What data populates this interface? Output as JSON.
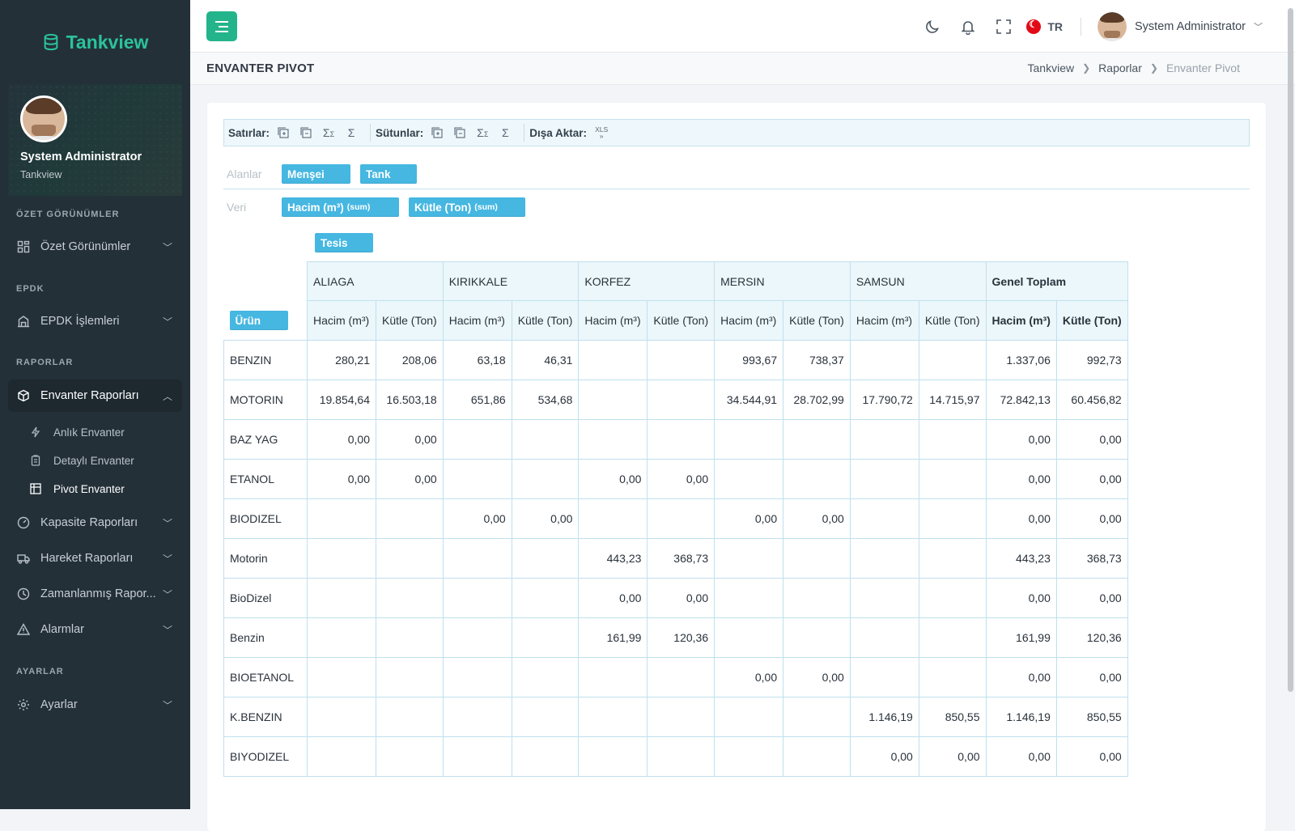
{
  "brand": {
    "name": "Tankview"
  },
  "profile": {
    "name": "System Administrator",
    "org": "Tankview"
  },
  "nav": {
    "sections": {
      "ozet": "ÖZET GÖRÜNÜMLER",
      "epdk": "EPDK",
      "raporlar": "RAPORLAR",
      "ayarlar": "AYARLAR"
    },
    "items": {
      "ozet": "Özet Görünümler",
      "epdk": "EPDK İşlemleri",
      "envanter": "Envanter Raporları",
      "kapasite": "Kapasite Raporları",
      "hareket": "Hareket Raporları",
      "zaman": "Zamanlanmış Rapor...",
      "alarm": "Alarmlar",
      "ayarlar": "Ayarlar"
    },
    "subitems": {
      "anlik": "Anlık Envanter",
      "detayli": "Detaylı Envanter",
      "pivot": "Pivot Envanter"
    }
  },
  "header": {
    "language": "TR",
    "user": "System Administrator"
  },
  "page": {
    "title": "ENVANTER PIVOT",
    "breadcrumb": [
      "Tankview",
      "Raporlar",
      "Envanter Pivot"
    ]
  },
  "toolbar": {
    "rows": "Satırlar:",
    "cols": "Sütunlar:",
    "export": "Dışa Aktar:",
    "xls": "XLS"
  },
  "zones": {
    "alanlar_label": "Alanlar",
    "alanlar": [
      "Menşei",
      "Tank"
    ],
    "veri_label": "Veri",
    "veri": [
      {
        "name": "Hacim (m³)",
        "agg": "(sum)"
      },
      {
        "name": "Kütle (Ton)",
        "agg": "(sum)"
      }
    ],
    "column_field": "Tesis",
    "row_field": "Ürün"
  },
  "pivot": {
    "columns": [
      "ALIAGA",
      "KIRIKKALE",
      "KORFEZ",
      "MERSIN",
      "SAMSUN"
    ],
    "total_label": "Genel Toplam",
    "measures": [
      "Hacim (m³)",
      "Kütle (Ton)"
    ],
    "rows": [
      {
        "label": "BENZIN",
        "cells": [
          "280,21",
          "208,06",
          "63,18",
          "46,31",
          "",
          "",
          "993,67",
          "738,37",
          "",
          "",
          "1.337,06",
          "992,73"
        ]
      },
      {
        "label": "MOTORIN",
        "cells": [
          "19.854,64",
          "16.503,18",
          "651,86",
          "534,68",
          "",
          "",
          "34.544,91",
          "28.702,99",
          "17.790,72",
          "14.715,97",
          "72.842,13",
          "60.456,82"
        ]
      },
      {
        "label": "BAZ YAG",
        "cells": [
          "0,00",
          "0,00",
          "",
          "",
          "",
          "",
          "",
          "",
          "",
          "",
          "0,00",
          "0,00"
        ]
      },
      {
        "label": "ETANOL",
        "cells": [
          "0,00",
          "0,00",
          "",
          "",
          "0,00",
          "0,00",
          "",
          "",
          "",
          "",
          "0,00",
          "0,00"
        ]
      },
      {
        "label": "BIODIZEL",
        "cells": [
          "",
          "",
          "0,00",
          "0,00",
          "",
          "",
          "0,00",
          "0,00",
          "",
          "",
          "0,00",
          "0,00"
        ]
      },
      {
        "label": "Motorin",
        "cells": [
          "",
          "",
          "",
          "",
          "443,23",
          "368,73",
          "",
          "",
          "",
          "",
          "443,23",
          "368,73"
        ]
      },
      {
        "label": "BioDizel",
        "cells": [
          "",
          "",
          "",
          "",
          "0,00",
          "0,00",
          "",
          "",
          "",
          "",
          "0,00",
          "0,00"
        ]
      },
      {
        "label": "Benzin",
        "cells": [
          "",
          "",
          "",
          "",
          "161,99",
          "120,36",
          "",
          "",
          "",
          "",
          "161,99",
          "120,36"
        ]
      },
      {
        "label": "BIOETANOL",
        "cells": [
          "",
          "",
          "",
          "",
          "",
          "",
          "0,00",
          "0,00",
          "",
          "",
          "0,00",
          "0,00"
        ]
      },
      {
        "label": "K.BENZIN",
        "cells": [
          "",
          "",
          "",
          "",
          "",
          "",
          "",
          "",
          "1.146,19",
          "850,55",
          "1.146,19",
          "850,55"
        ]
      },
      {
        "label": "BIYODIZEL",
        "cells": [
          "",
          "",
          "",
          "",
          "",
          "",
          "",
          "",
          "0,00",
          "0,00",
          "0,00",
          "0,00"
        ]
      }
    ]
  },
  "colors": {
    "accent": "#23b48b",
    "pill": "#45b7e1",
    "sidebar": "#243038"
  }
}
